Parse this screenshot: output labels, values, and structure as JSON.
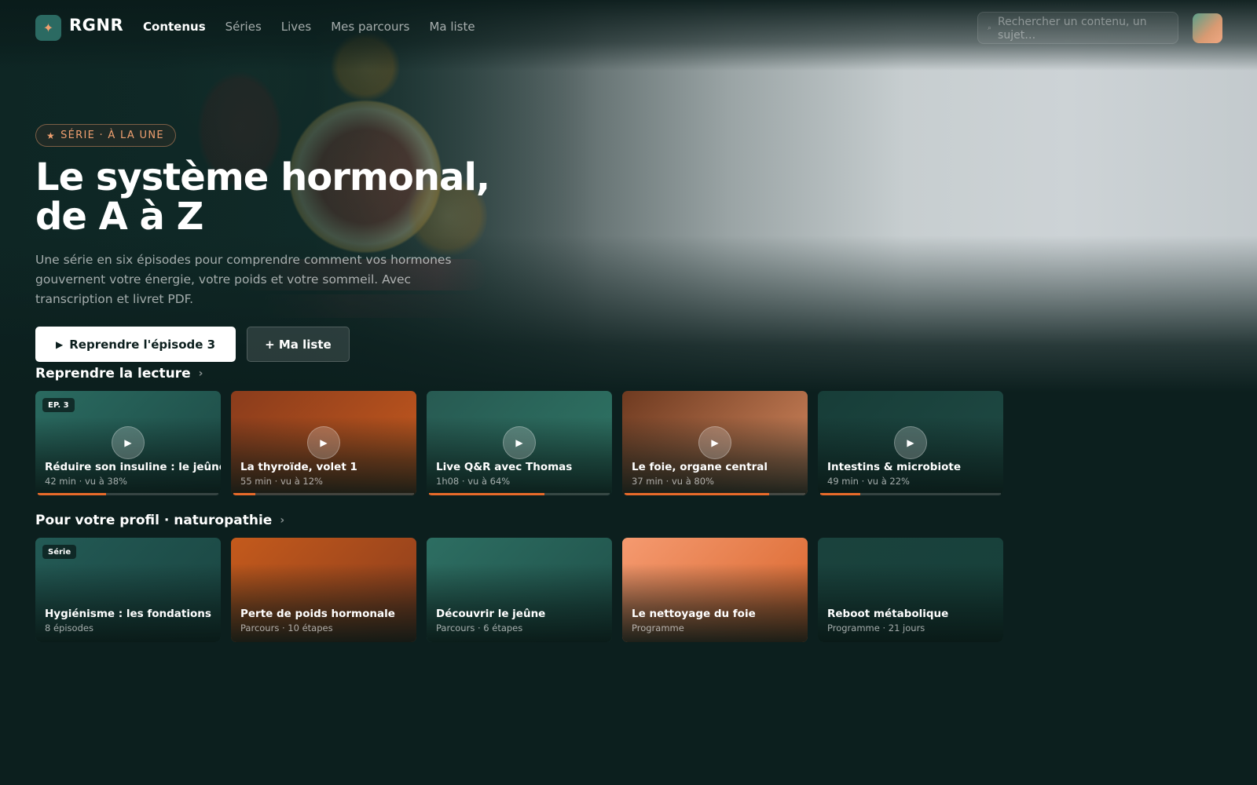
{
  "app": {
    "logo_glyph": "✦",
    "name": "RGNR"
  },
  "nav": {
    "items": [
      {
        "label": "Contenus",
        "active": true
      },
      {
        "label": "Séries",
        "active": false
      },
      {
        "label": "Lives",
        "active": false
      },
      {
        "label": "Mes parcours",
        "active": false
      },
      {
        "label": "Ma liste",
        "active": false
      }
    ],
    "search": {
      "placeholder": "Rechercher un contenu, un sujet…",
      "icon": "search-icon"
    }
  },
  "hero": {
    "badge": "SÉRIE · À LA UNE",
    "badge_icon": "star-icon",
    "title_line1": "Le système hormonal,",
    "title_line2": "de A à Z",
    "description": "Une série en six épisodes pour comprendre comment vos hormones gouvernent votre énergie, votre poids et votre sommeil. Avec transcription et livret PDF.",
    "primary_button": "Reprendre l'épisode 3",
    "secondary_button": "+ Ma liste"
  },
  "continue_section": {
    "title": "Reprendre la lecture",
    "items": [
      {
        "tag": "EP. 3",
        "title": "Réduire son insuline : le jeûne",
        "meta": "42 min · vu à 38%",
        "progress": 38,
        "colors": [
          "#2a6a60",
          "#1d4a45"
        ]
      },
      {
        "tag": "",
        "title": "La thyroïde, volet 1",
        "meta": "55 min · vu à 12%",
        "progress": 12,
        "colors": [
          "#8a3c1c",
          "#c75a1e"
        ]
      },
      {
        "tag": "",
        "title": "Live Q&R avec Thomas",
        "meta": "1h08 · vu à 64%",
        "progress": 64,
        "colors": [
          "#275a52",
          "#2f7565"
        ]
      },
      {
        "tag": "",
        "title": "Le foie, organe central",
        "meta": "37 min · vu à 80%",
        "progress": 80,
        "colors": [
          "#6e3a20",
          "#d68a60"
        ]
      },
      {
        "tag": "",
        "title": "Intestins & microbiote",
        "meta": "49 min · vu à 22%",
        "progress": 22,
        "colors": [
          "#173d38",
          "#1f4a44"
        ]
      }
    ]
  },
  "profile_section": {
    "title": "Pour votre profil · naturopathie",
    "items": [
      {
        "tag": "Série",
        "title": "Hygiénisme : les fondations",
        "meta": "8 épisodes",
        "colors": [
          "#235a55",
          "#1a4541"
        ]
      },
      {
        "tag": "",
        "title": "Perte de poids hormonale",
        "meta": "Parcours · 10 étapes",
        "colors": [
          "#c45a1c",
          "#8a3c1c"
        ]
      },
      {
        "tag": "",
        "title": "Découvrir le jeûne",
        "meta": "Parcours · 6 étapes",
        "colors": [
          "#2d6e62",
          "#1f5049"
        ]
      },
      {
        "tag": "",
        "title": "Le nettoyage du foie",
        "meta": "Programme",
        "colors": [
          "#f59a70",
          "#d8642a"
        ]
      },
      {
        "tag": "",
        "title": "Reboot métabolique",
        "meta": "Programme · 21 jours",
        "colors": [
          "#1a423d",
          "#17403a"
        ]
      }
    ]
  }
}
